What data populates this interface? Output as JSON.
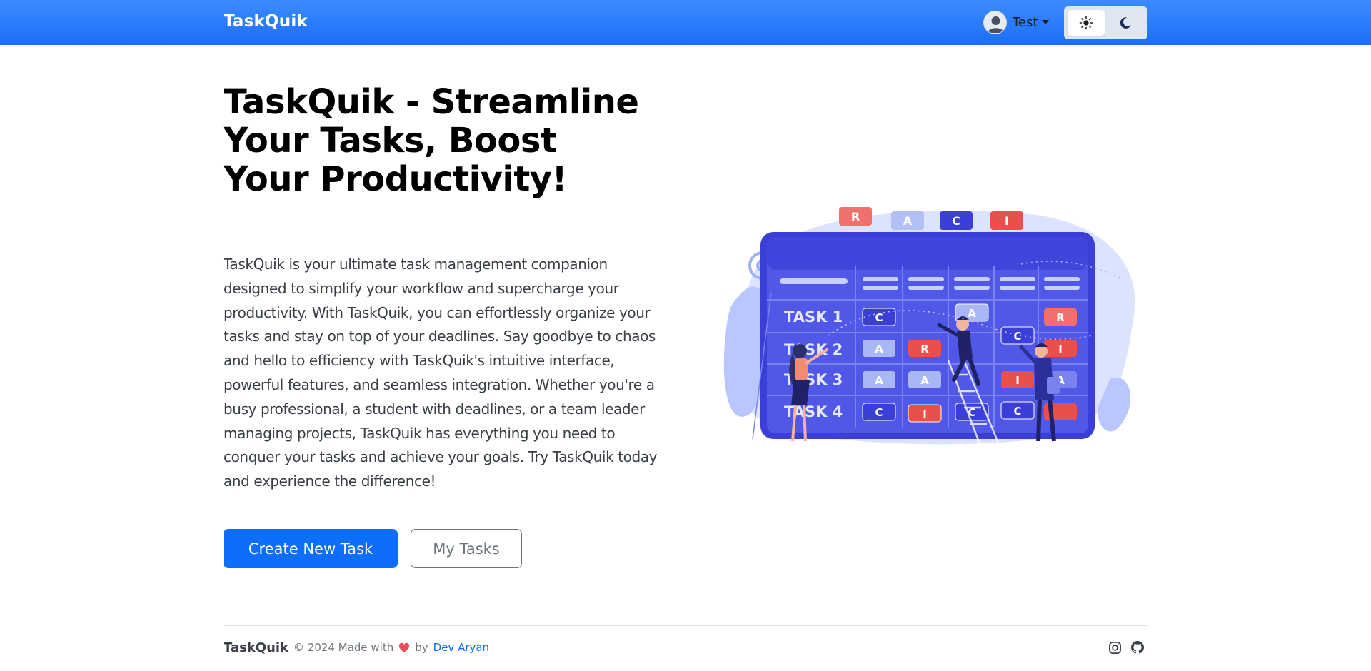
{
  "navbar": {
    "brand": "TaskQuik",
    "user": {
      "name": "Test",
      "avatar_icon": "user-avatar-icon"
    },
    "theme_toggle": {
      "light_icon": "sun-icon",
      "dark_icon": "moon-icon",
      "active": "light"
    },
    "colors": {
      "bar_top": "#3d8bff",
      "bar_bottom": "#1b6ef5"
    }
  },
  "hero": {
    "title": "TaskQuik - Streamline Your Tasks, Boost Your Productivity!",
    "description": "TaskQuik is your ultimate task management companion designed to simplify your workflow and supercharge your productivity. With TaskQuik, you can effortlessly organize your tasks and stay on top of your deadlines. Say goodbye to chaos and hello to efficiency with TaskQuik's intuitive interface, powerful features, and seamless integration. Whether you're a busy professional, a student with deadlines, or a team leader managing projects, TaskQuik has everything you need to conquer your tasks and achieve your goals. Try TaskQuik today and experience the difference!",
    "primary_button": "Create New Task",
    "secondary_button": "My Tasks"
  },
  "illustration": {
    "header_tags": [
      "R",
      "A",
      "C",
      "I"
    ],
    "rows": [
      {
        "label": "TASK 1",
        "cells": [
          "C",
          "",
          "A",
          "",
          "R"
        ]
      },
      {
        "label": "TASK 2",
        "cells": [
          "A",
          "R",
          "",
          "C",
          "I"
        ]
      },
      {
        "label": "TASK 3",
        "cells": [
          "A",
          "A",
          "",
          "I",
          "A"
        ]
      },
      {
        "label": "TASK 4",
        "cells": [
          "C",
          "I",
          "C",
          "C",
          ""
        ]
      }
    ],
    "colors": {
      "board": "#5157e6",
      "frame": "#3b3fd8",
      "red": "#e8504e",
      "light": "#a9b7f5",
      "blob": "#c7d3ff"
    }
  },
  "footer": {
    "brand": "TaskQuik",
    "copyright": "© 2024 Made with",
    "by": "by",
    "author": "Dev Aryan",
    "heart_icon": "heart-icon",
    "social": [
      "instagram-icon",
      "github-icon"
    ]
  }
}
